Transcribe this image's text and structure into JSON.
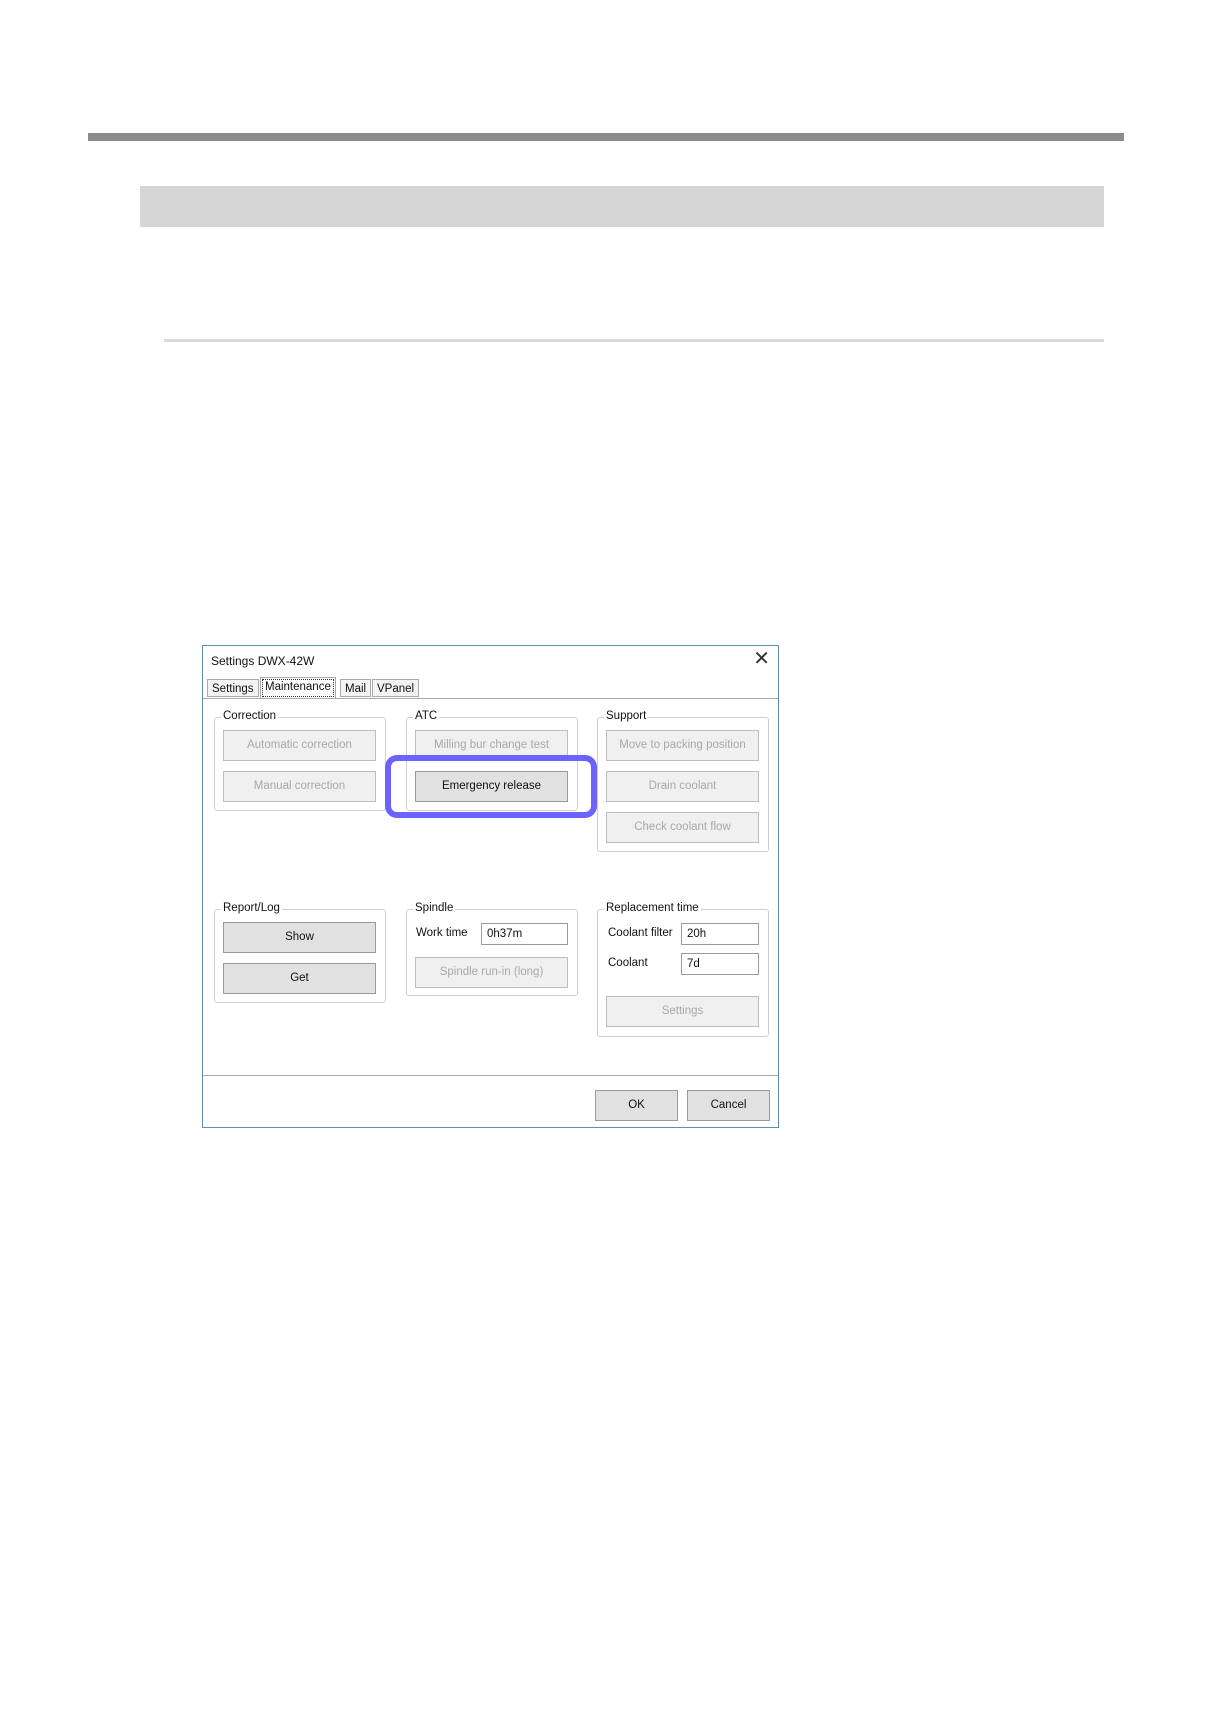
{
  "dialog": {
    "title": "Settings DWX-42W",
    "tabs": [
      {
        "label": "Settings"
      },
      {
        "label": "Maintenance"
      },
      {
        "label": "Mail"
      },
      {
        "label": "VPanel"
      }
    ],
    "correction": {
      "legend": "Correction",
      "automatic": "Automatic correction",
      "manual": "Manual correction"
    },
    "atc": {
      "legend": "ATC",
      "milling_test": "Milling bur change test",
      "emergency": "Emergency release"
    },
    "support": {
      "legend": "Support",
      "move_packing": "Move to packing position",
      "drain": "Drain coolant",
      "check_flow": "Check coolant flow"
    },
    "report": {
      "legend": "Report/Log",
      "show": "Show",
      "get": "Get"
    },
    "spindle": {
      "legend": "Spindle",
      "work_time_label": "Work time",
      "work_time_value": "0h37m",
      "run_in": "Spindle run-in (long)"
    },
    "replacement": {
      "legend": "Replacement time",
      "filter_label": "Coolant filter",
      "filter_value": "20h",
      "coolant_label": "Coolant",
      "coolant_value": "7d",
      "settings": "Settings"
    },
    "ok": "OK",
    "cancel": "Cancel"
  },
  "colors": {
    "highlight": "#6c63ff",
    "dialog_border": "#5d8fb9"
  }
}
